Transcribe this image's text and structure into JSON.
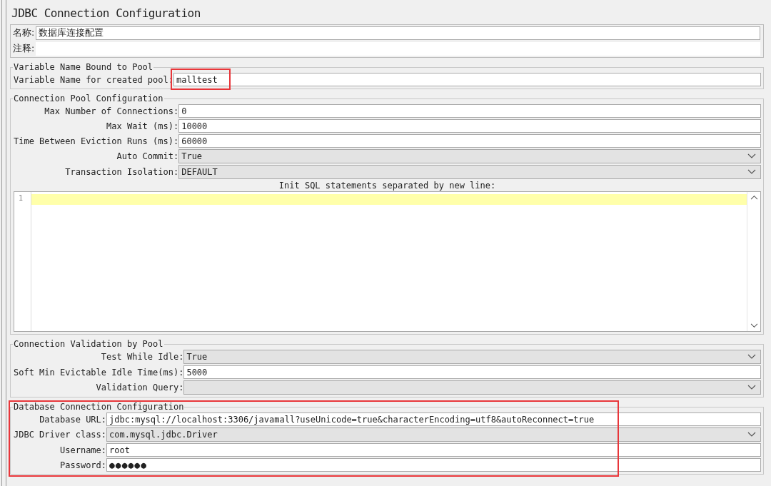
{
  "title": "JDBC Connection Configuration",
  "name_field": {
    "label": "名称:",
    "value": "数据库连接配置"
  },
  "comment_field": {
    "label": "注释:"
  },
  "sections": [
    {
      "title": "Variable Name Bound to Pool",
      "highlighted": false,
      "rows": [
        {
          "label": "Variable Name for created pool:",
          "value": "malltest",
          "kind": "text",
          "highlighted": true
        }
      ]
    },
    {
      "title": "Connection Pool Configuration",
      "highlighted": false,
      "rows": [
        {
          "label": "Max Number of Connections:",
          "value": "0",
          "kind": "text",
          "highlighted": false
        },
        {
          "label": "Max Wait (ms):",
          "value": "10000",
          "kind": "text",
          "highlighted": false
        },
        {
          "label": "Time Between Eviction Runs (ms):",
          "value": "60000",
          "kind": "text",
          "highlighted": false
        },
        {
          "label": "Auto Commit:",
          "value": "True",
          "kind": "select",
          "highlighted": false
        },
        {
          "label": "Transaction Isolation:",
          "value": "DEFAULT",
          "kind": "select",
          "highlighted": false
        }
      ],
      "editor": {
        "caption": "Init SQL statements separated by new line:",
        "line_numbers": [
          "1"
        ]
      }
    },
    {
      "title": "Connection Validation by Pool",
      "highlighted": false,
      "rows": [
        {
          "label": "Test While Idle:",
          "value": "True",
          "kind": "select",
          "highlighted": false
        },
        {
          "label": "Soft Min Evictable Idle Time(ms):",
          "value": "5000",
          "kind": "text",
          "highlighted": false
        },
        {
          "label": "Validation Query:",
          "value": "",
          "kind": "select",
          "highlighted": false
        }
      ]
    },
    {
      "title": "Database Connection Configuration",
      "highlighted": true,
      "rows": [
        {
          "label": "Database URL:",
          "value": "jdbc:mysql://localhost:3306/javamall?useUnicode=true&characterEncoding=utf8&autoReconnect=true",
          "kind": "text",
          "highlighted": false
        },
        {
          "label": "JDBC Driver class:",
          "value": "com.mysql.jdbc.Driver",
          "kind": "select",
          "highlighted": false
        },
        {
          "label": "Username:",
          "value": "root",
          "kind": "text",
          "highlighted": false
        },
        {
          "label": "Password:",
          "value": "●●●●●●",
          "kind": "password",
          "highlighted": false
        }
      ]
    }
  ]
}
